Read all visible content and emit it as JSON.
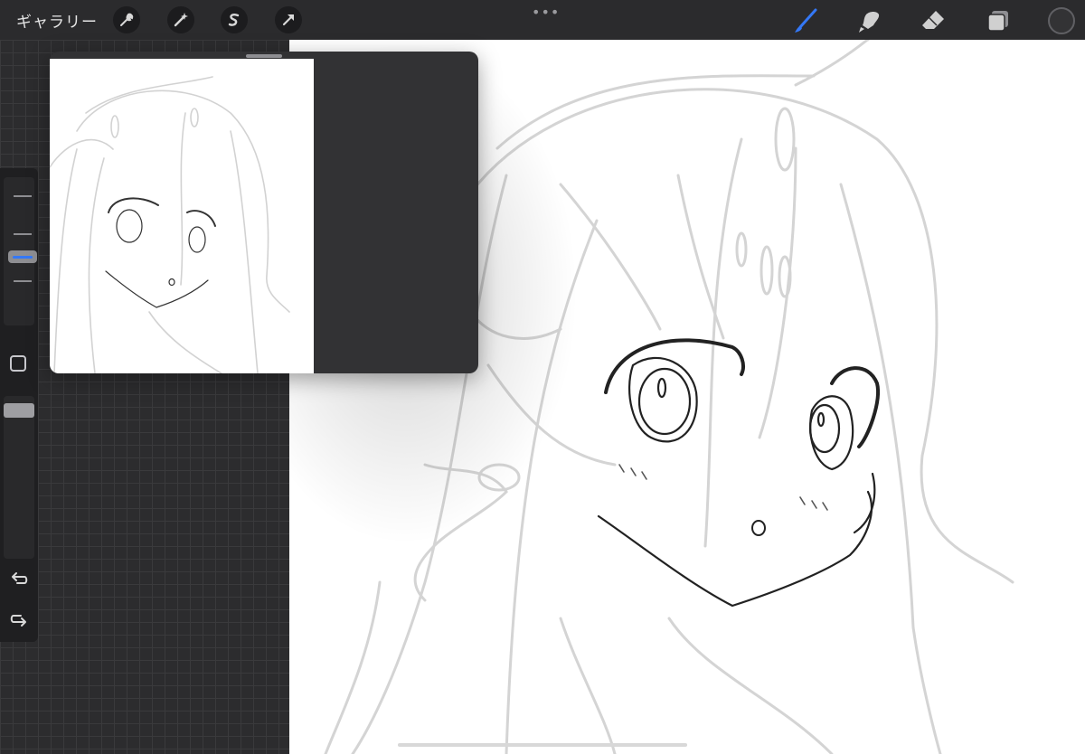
{
  "topbar": {
    "gallery_label": "ギャラリー",
    "left_tools": [
      {
        "icon": "wrench-icon"
      },
      {
        "icon": "magic-wand-icon"
      },
      {
        "icon": "selection-s-icon"
      },
      {
        "icon": "arrow-transform-icon"
      }
    ],
    "more_label": "•••",
    "right_tools": [
      {
        "icon": "brush-icon",
        "active": true
      },
      {
        "icon": "smudge-icon",
        "active": false
      },
      {
        "icon": "eraser-icon",
        "active": false
      },
      {
        "icon": "layers-icon",
        "active": false
      }
    ],
    "current_color": "#333335"
  },
  "sidebar": {
    "brush_size_level": 0.34,
    "opacity_level": 0.0
  },
  "colors": {
    "accent": "#3478f6",
    "sketch_line": "#d0d0d0",
    "ink_line": "#222222"
  }
}
